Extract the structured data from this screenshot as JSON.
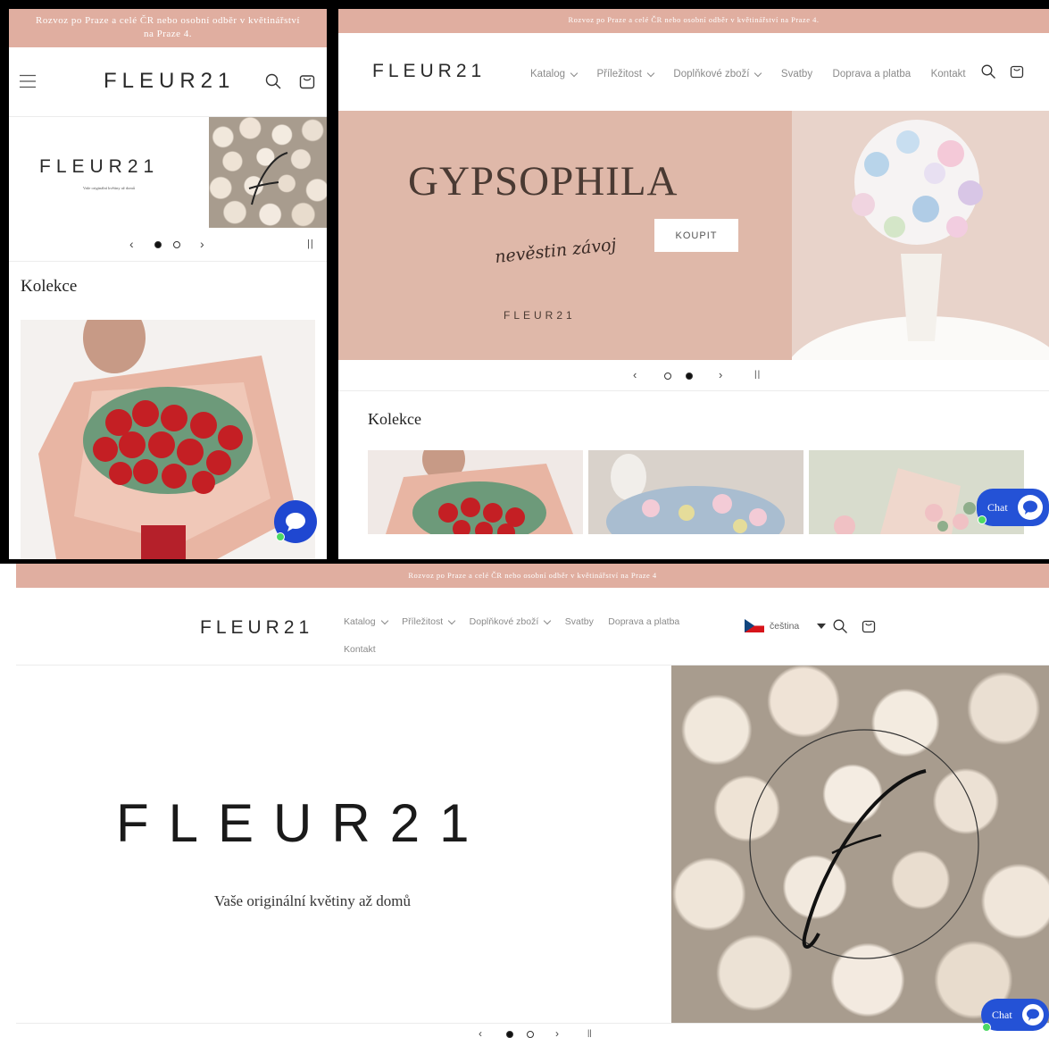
{
  "announcement": "Rozvoz po Praze a celé ČR nebo osobní odběr v květinářství na Praze 4.",
  "announcement_desktop": "Rozvoz po Praze a celé ČR nebo osobní odběr v květinářství na Praze 4",
  "logo": "FLEUR21",
  "tagline": "Vaše originální květiny až domů",
  "nav": {
    "katalog": "Katalog",
    "prilezitost": "Příležitost",
    "doplnkove": "Doplňkové zboží",
    "svatby": "Svatby",
    "doprava": "Doprava a platba",
    "kontakt": "Kontakt"
  },
  "language": "čeština",
  "hero2": {
    "title": "GYPSOPHILA",
    "script": "nevěstin závoj",
    "button": "KOUPIT",
    "brand": "FLEUR21"
  },
  "collections_heading": "Kolekce",
  "chat_label": "Chat",
  "colors": {
    "announcement_bg": "#e0aea0",
    "hero_pink": "#dfb8a9",
    "chat_blue": "#2452d6",
    "online_green": "#4cd964"
  },
  "icons": [
    "menu-icon",
    "search-icon",
    "cart-icon",
    "chevron-left-icon",
    "chevron-right-icon",
    "pause-icon",
    "chat-bubble-icon",
    "czech-flag-icon",
    "caret-down-icon"
  ]
}
